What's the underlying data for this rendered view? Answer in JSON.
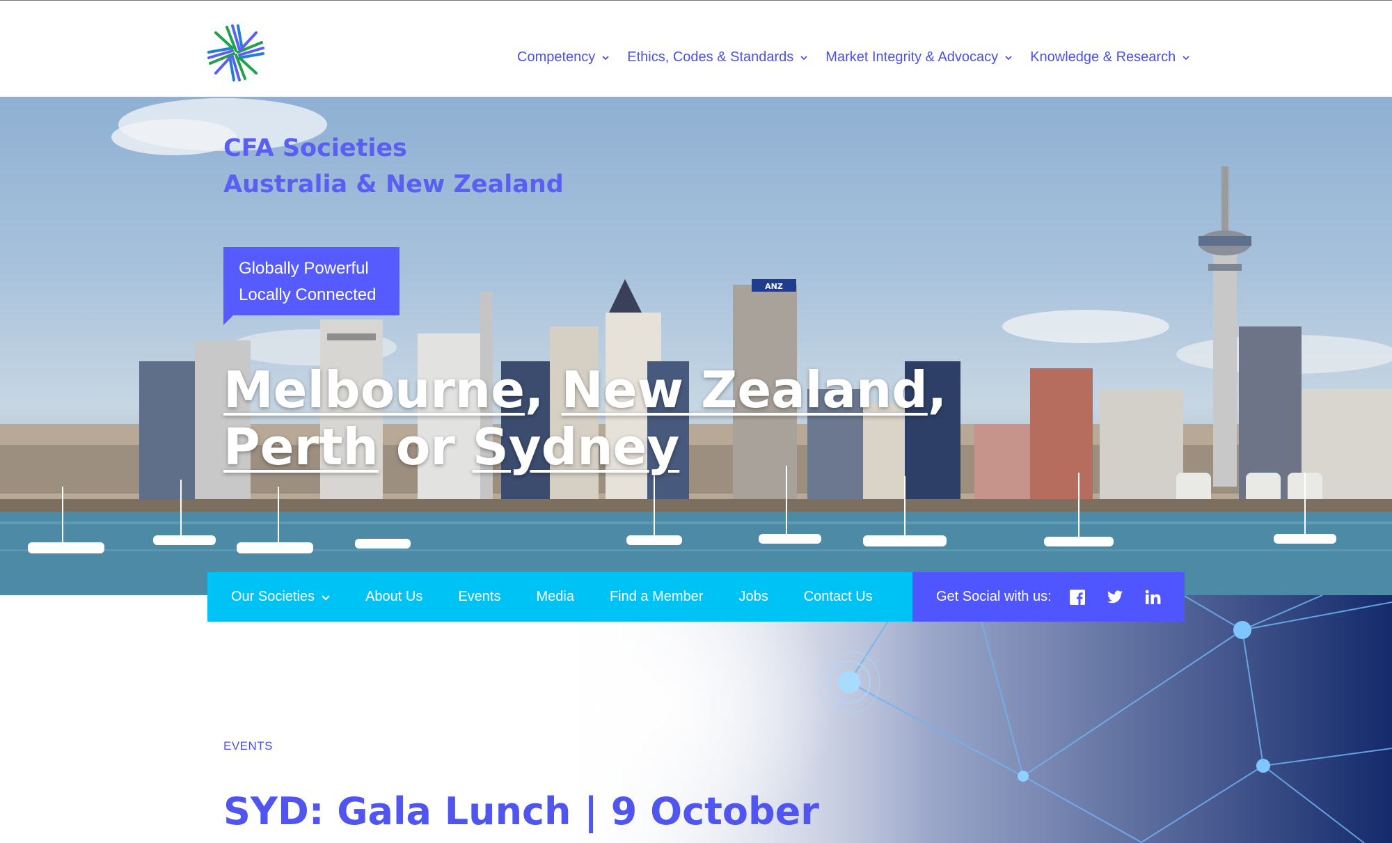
{
  "header": {
    "logo_name": "cfa-logo",
    "nav": [
      {
        "label": "Competency"
      },
      {
        "label": "Ethics, Codes & Standards"
      },
      {
        "label": "Market Integrity & Advocacy"
      },
      {
        "label": "Knowledge & Research"
      }
    ]
  },
  "hero": {
    "subtitle_line1": "CFA Societies",
    "subtitle_line2": "Australia & New Zealand",
    "badge_line1": "Globally Powerful",
    "badge_line2": "Locally Connected",
    "cities": {
      "melbourne": "Melbourne",
      "sep1": ", ",
      "new_zealand": "New Zealand",
      "sep2": ",",
      "perth": "Perth",
      "or": " or ",
      "sydney": "Sydney"
    },
    "sign_text": "ANZ"
  },
  "subnav": {
    "items": [
      {
        "label": "Our Societies"
      },
      {
        "label": "About Us"
      },
      {
        "label": "Events"
      },
      {
        "label": "Media"
      },
      {
        "label": "Find a Member"
      },
      {
        "label": "Jobs"
      },
      {
        "label": "Contact Us"
      }
    ],
    "social_label": "Get Social with us:",
    "social_icons": [
      "facebook-icon",
      "twitter-icon",
      "linkedin-icon"
    ]
  },
  "events": {
    "label": "EVENTS",
    "title": "SYD: Gala Lunch | 9 October"
  },
  "colors": {
    "brand_blue": "#4a50e8",
    "cyan": "#00c3f5",
    "violet": "#5056ff"
  }
}
